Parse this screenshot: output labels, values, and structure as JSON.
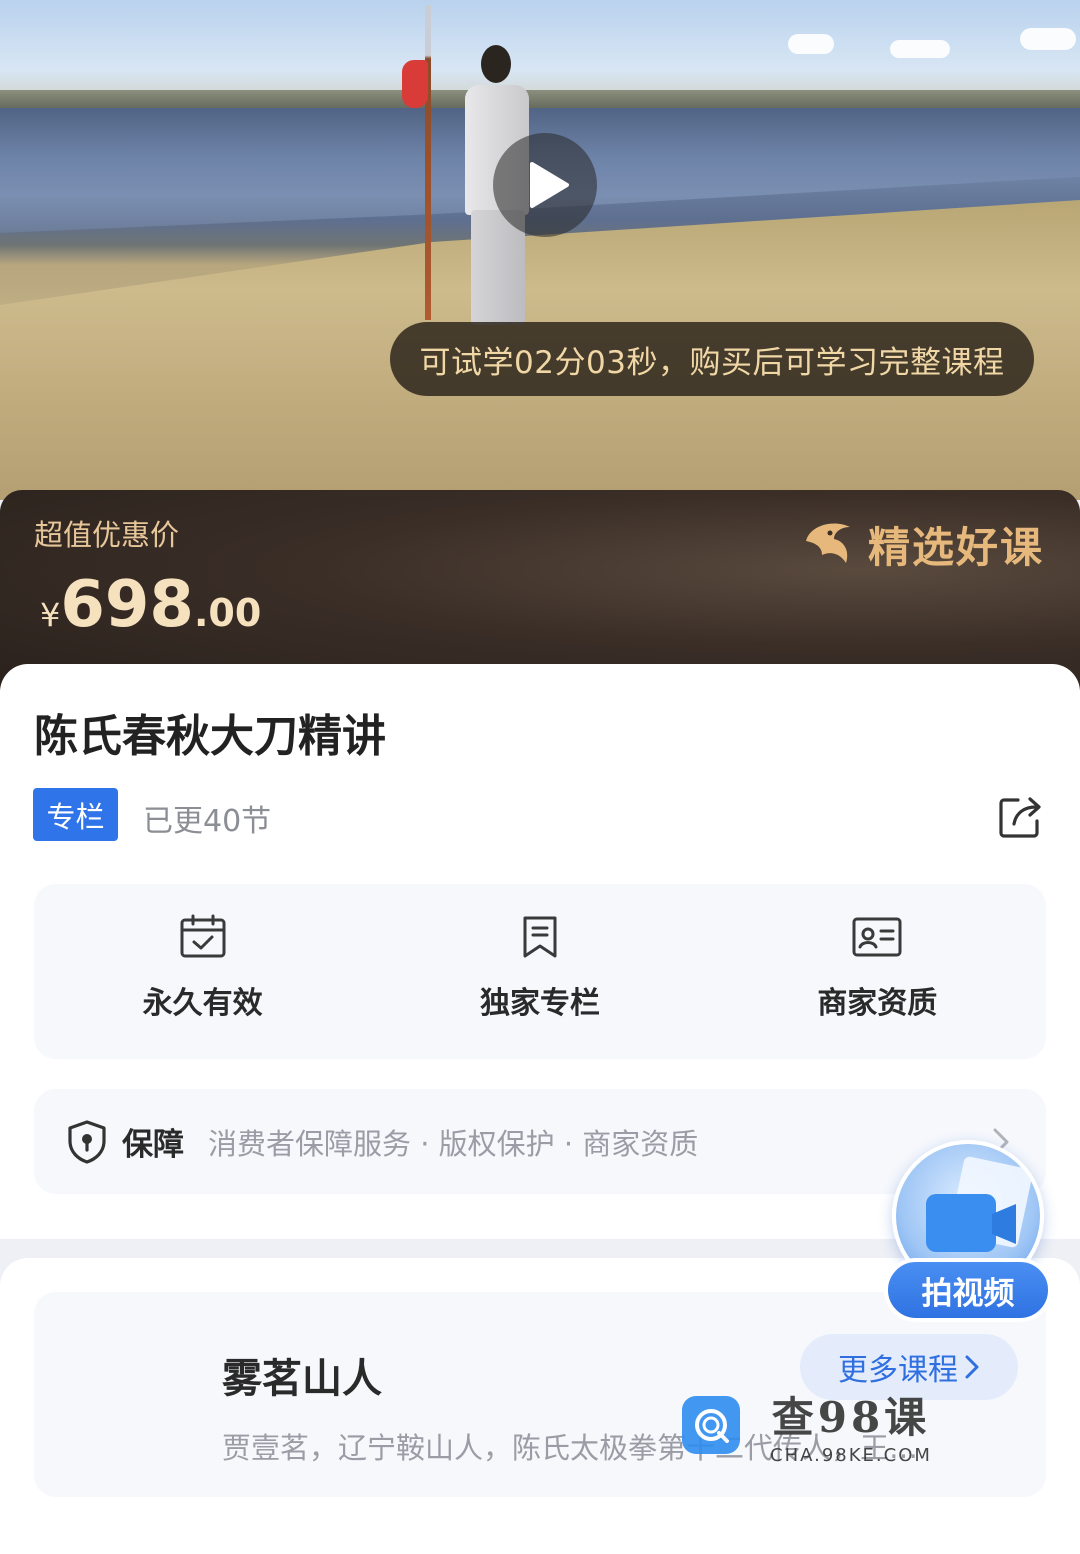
{
  "video": {
    "trial_text": "可试学02分03秒，购买后可学习完整课程"
  },
  "price": {
    "label": "超值优惠价",
    "currency": "¥",
    "integer": "698",
    "decimal": ".00"
  },
  "brand": {
    "text": "精选好课",
    "color": "#e6b87b"
  },
  "course": {
    "title": "陈氏春秋大刀精讲",
    "tag": "专栏",
    "updated": "已更40节"
  },
  "features": [
    {
      "icon": "calendar-check-icon",
      "label": "永久有效"
    },
    {
      "icon": "bookmark-icon",
      "label": "独家专栏"
    },
    {
      "icon": "id-card-icon",
      "label": "商家资质"
    }
  ],
  "guarantee": {
    "title": "保障",
    "items": "消费者保障服务 · 版权保护 · 商家资质"
  },
  "teacher": {
    "name": "雾茗山人",
    "description": "贾壹茗，辽宁鞍山人，陈氏太极拳第十二代传人，王…",
    "more_label": "更多课程"
  },
  "float_button": {
    "label": "拍视频"
  },
  "watermark": {
    "main": "查98课",
    "sub": "CHA.98KE.COM"
  },
  "colors": {
    "accent": "#2f74e8",
    "price_text": "#f6e1be",
    "trial_text": "#f1d7a6"
  }
}
